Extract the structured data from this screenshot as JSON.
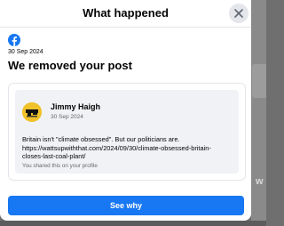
{
  "dialog": {
    "title": "What happened",
    "date": "30 Sep 2024",
    "heading": "We removed your post"
  },
  "post": {
    "author": "Jimmy Haigh",
    "date": "30 Sep 2024",
    "text_lines": [
      "Britain isn't \"climate obsessed\". But our politicians are.",
      "https://wattsupwiththat.com/2024/09/30/climate-obsessed-britain-",
      "closes-last-coal-plant/"
    ],
    "shared_note": "You shared this on your profile"
  },
  "actions": {
    "see_why": "See why"
  },
  "icons": {
    "close": "close-icon",
    "brand": "facebook-icon",
    "avatar": "avatar"
  },
  "colors": {
    "brand_blue": "#1877F2",
    "card_bg": "#F0F2F5",
    "avatar_yellow": "#F0C22A"
  },
  "backdrop": {
    "edge_letter": "w"
  }
}
